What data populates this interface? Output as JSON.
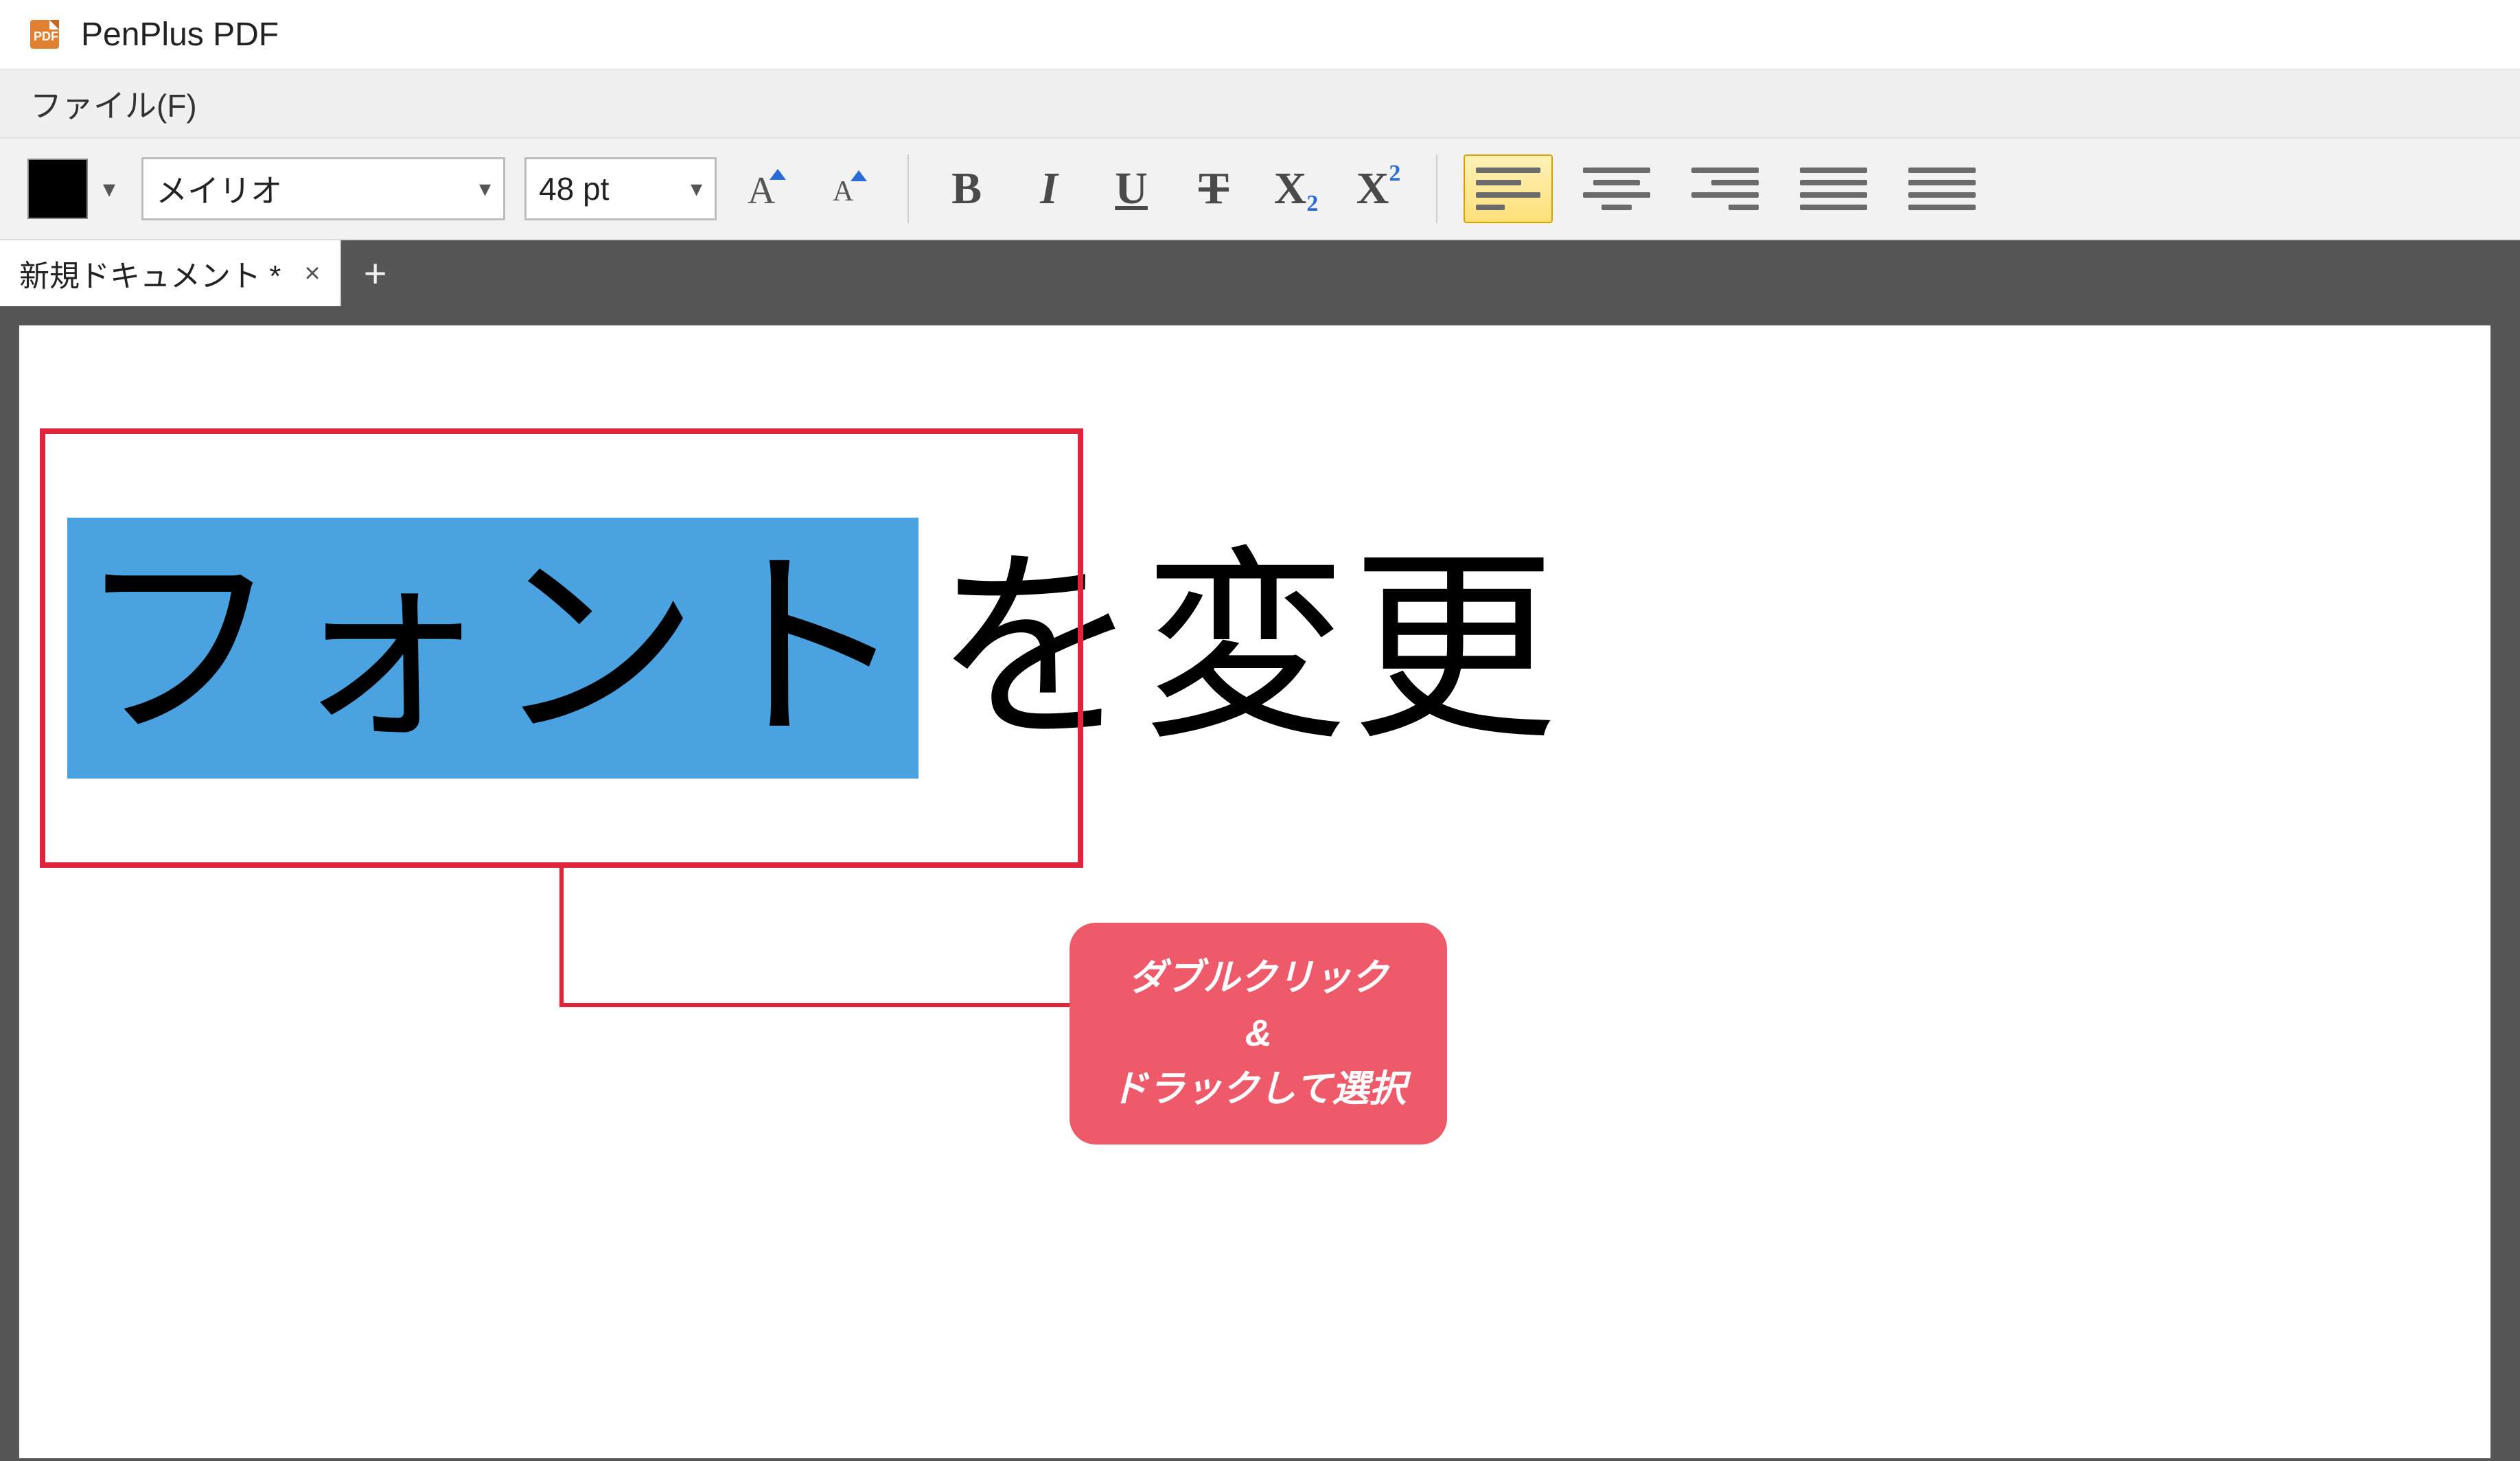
{
  "app": {
    "title": "PenPlus PDF"
  },
  "menu": {
    "file": "ファイル(F)"
  },
  "toolbar": {
    "color_swatch": "#000000",
    "font_name": "メイリオ",
    "font_size_label": "48 pt",
    "increase_font_tip": "A▲",
    "decrease_font_tip": "A▼",
    "bold": "B",
    "italic": "I",
    "underline": "U",
    "strike": "T",
    "subscript_base": "X",
    "subscript_sub": "2",
    "superscript_base": "X",
    "superscript_sup": "2"
  },
  "tabs": {
    "active_label": "新規ドキュメント *",
    "close_glyph": "×",
    "new_glyph": "+"
  },
  "document": {
    "textbox": {
      "selected_text": "フォント",
      "unselected_text": "を変更"
    }
  },
  "annotation": {
    "callout_line1": "ダブルクリック",
    "callout_line2": "&",
    "callout_line3": "ドラックして選択",
    "rect_color": "#e0243b",
    "callout_bg": "#ef5a6b"
  }
}
